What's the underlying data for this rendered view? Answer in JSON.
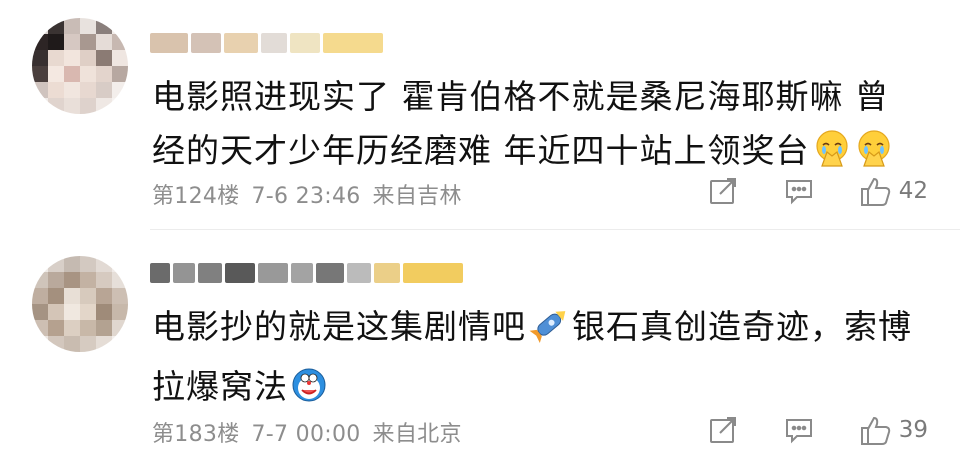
{
  "comments": [
    {
      "text_line1": "电影照进现实了 霍肯伯格不就是桑尼海耶斯嘛 曾",
      "text_line2": "经的天才少年历经磨难 年近四十站上领奖台",
      "floor": "第124楼",
      "date": "7-6",
      "time": "23:46",
      "location": "来自吉林",
      "likes": "42",
      "emoji": "crying-pray-emoji"
    },
    {
      "text_line1": "电影抄的就是这集剧情吧",
      "text_line1b": "银石真创造奇迹，索博",
      "text_line2": "拉爆窝法",
      "floor": "第183楼",
      "date": "7-7",
      "time": "00:00",
      "location": "来自北京",
      "likes": "39",
      "emoji": "rocket-emoji"
    }
  ],
  "colors": {
    "meta_text": "#8d8d8d",
    "body_text": "#111111",
    "icon_stroke": "#8a8a8a",
    "divider": "#ececec"
  }
}
